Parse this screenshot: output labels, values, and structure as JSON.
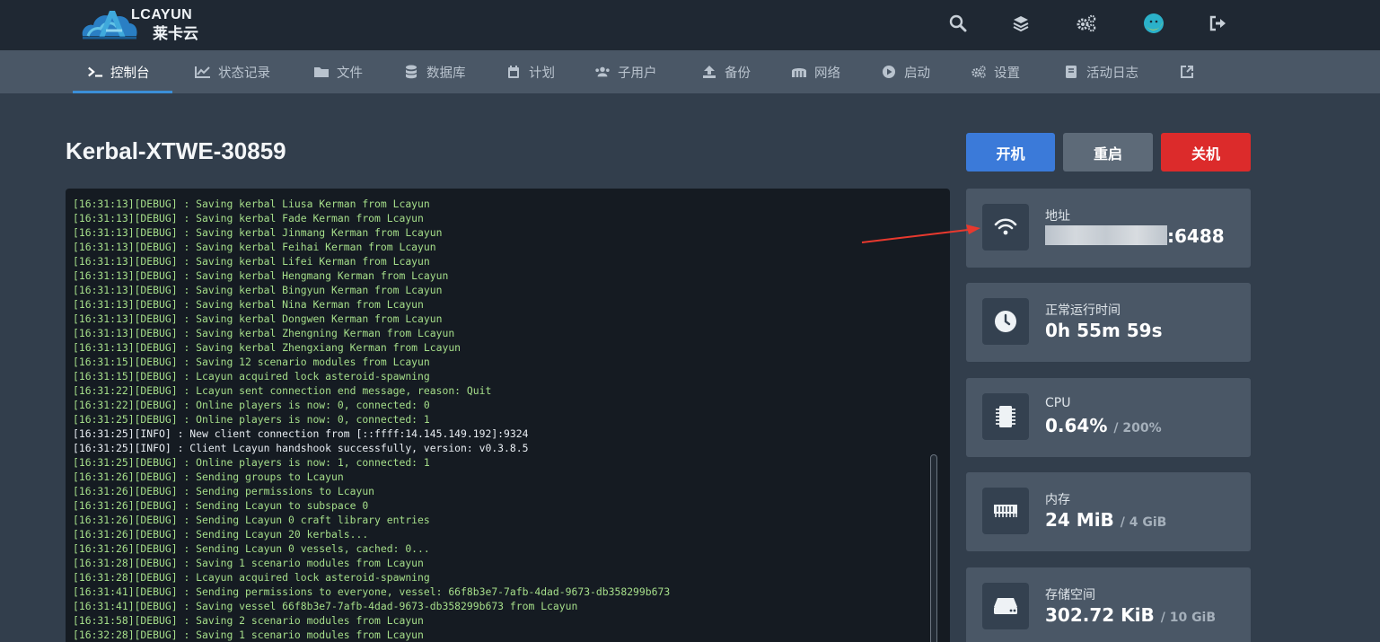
{
  "brand": {
    "name_en": "LCAYUN",
    "name_cn": "莱卡云"
  },
  "topbar": {
    "icons": [
      "search-icon",
      "layers-icon",
      "cogs-icon",
      "avatar",
      "logout-icon"
    ]
  },
  "nav": {
    "items": [
      {
        "label": "控制台",
        "icon": "terminal-icon"
      },
      {
        "label": "状态记录",
        "icon": "chart-icon"
      },
      {
        "label": "文件",
        "icon": "folder-icon"
      },
      {
        "label": "数据库",
        "icon": "database-icon"
      },
      {
        "label": "计划",
        "icon": "calendar-icon"
      },
      {
        "label": "子用户",
        "icon": "users-icon"
      },
      {
        "label": "备份",
        "icon": "upload-icon"
      },
      {
        "label": "网络",
        "icon": "network-icon"
      },
      {
        "label": "启动",
        "icon": "play-icon"
      },
      {
        "label": "设置",
        "icon": "cogs-icon"
      },
      {
        "label": "活动日志",
        "icon": "book-icon"
      },
      {
        "label": "",
        "icon": "external-link-icon"
      }
    ]
  },
  "server": {
    "name": "Kerbal-XTWE-30859"
  },
  "power": {
    "start": "开机",
    "restart": "重启",
    "stop": "关机"
  },
  "console": {
    "lines": [
      {
        "level": "debug",
        "text": "[16:31:13][DEBUG] : Saving kerbal Liusa Kerman from Lcayun"
      },
      {
        "level": "debug",
        "text": "[16:31:13][DEBUG] : Saving kerbal Fade Kerman from Lcayun"
      },
      {
        "level": "debug",
        "text": "[16:31:13][DEBUG] : Saving kerbal Jinmang Kerman from Lcayun"
      },
      {
        "level": "debug",
        "text": "[16:31:13][DEBUG] : Saving kerbal Feihai Kerman from Lcayun"
      },
      {
        "level": "debug",
        "text": "[16:31:13][DEBUG] : Saving kerbal Lifei Kerman from Lcayun"
      },
      {
        "level": "debug",
        "text": "[16:31:13][DEBUG] : Saving kerbal Hengmang Kerman from Lcayun"
      },
      {
        "level": "debug",
        "text": "[16:31:13][DEBUG] : Saving kerbal Bingyun Kerman from Lcayun"
      },
      {
        "level": "debug",
        "text": "[16:31:13][DEBUG] : Saving kerbal Nina Kerman from Lcayun"
      },
      {
        "level": "debug",
        "text": "[16:31:13][DEBUG] : Saving kerbal Dongwen Kerman from Lcayun"
      },
      {
        "level": "debug",
        "text": "[16:31:13][DEBUG] : Saving kerbal Zhengning Kerman from Lcayun"
      },
      {
        "level": "debug",
        "text": "[16:31:13][DEBUG] : Saving kerbal Zhengxiang Kerman from Lcayun"
      },
      {
        "level": "debug",
        "text": "[16:31:15][DEBUG] : Saving 12 scenario modules from Lcayun"
      },
      {
        "level": "debug",
        "text": "[16:31:15][DEBUG] : Lcayun acquired lock asteroid-spawning"
      },
      {
        "level": "debug",
        "text": "[16:31:22][DEBUG] : Lcayun sent connection end message, reason: Quit"
      },
      {
        "level": "debug",
        "text": "[16:31:22][DEBUG] : Online players is now: 0, connected: 0"
      },
      {
        "level": "debug",
        "text": "[16:31:25][DEBUG] : Online players is now: 0, connected: 1"
      },
      {
        "level": "info",
        "text": "[16:31:25][INFO] : New client connection from [::ffff:14.145.149.192]:9324"
      },
      {
        "level": "info",
        "text": "[16:31:25][INFO] : Client Lcayun handshook successfully, version: v0.3.8.5"
      },
      {
        "level": "debug",
        "text": "[16:31:25][DEBUG] : Online players is now: 1, connected: 1"
      },
      {
        "level": "debug",
        "text": "[16:31:26][DEBUG] : Sending groups to Lcayun"
      },
      {
        "level": "debug",
        "text": "[16:31:26][DEBUG] : Sending permissions to Lcayun"
      },
      {
        "level": "debug",
        "text": "[16:31:26][DEBUG] : Sending Lcayun to subspace 0"
      },
      {
        "level": "debug",
        "text": "[16:31:26][DEBUG] : Sending Lcayun 0 craft library entries"
      },
      {
        "level": "debug",
        "text": "[16:31:26][DEBUG] : Sending Lcayun 20 kerbals..."
      },
      {
        "level": "debug",
        "text": "[16:31:26][DEBUG] : Sending Lcayun 0 vessels, cached: 0..."
      },
      {
        "level": "debug",
        "text": "[16:31:28][DEBUG] : Saving 1 scenario modules from Lcayun"
      },
      {
        "level": "debug",
        "text": "[16:31:28][DEBUG] : Lcayun acquired lock asteroid-spawning"
      },
      {
        "level": "debug",
        "text": "[16:31:41][DEBUG] : Sending permissions to everyone, vessel: 66f8b3e7-7afb-4dad-9673-db358299b673"
      },
      {
        "level": "debug",
        "text": "[16:31:41][DEBUG] : Saving vessel 66f8b3e7-7afb-4dad-9673-db358299b673 from Lcayun"
      },
      {
        "level": "debug",
        "text": "[16:31:58][DEBUG] : Saving 2 scenario modules from Lcayun"
      },
      {
        "level": "debug",
        "text": "[16:32:28][DEBUG] : Saving 1 scenario modules from Lcayun"
      }
    ]
  },
  "stats": {
    "address": {
      "label": "地址",
      "port": ":6488"
    },
    "uptime": {
      "label": "正常运行时间",
      "value": "0h 55m 59s"
    },
    "cpu": {
      "label": "CPU",
      "value": "0.64%",
      "limit": "/ 200%"
    },
    "memory": {
      "label": "内存",
      "value": "24 MiB",
      "limit": "/ 4 GiB"
    },
    "disk": {
      "label": "存储空间",
      "value": "302.72 KiB",
      "limit": "/ 10 GiB"
    }
  },
  "colors": {
    "start": "#3b7ad9",
    "restart": "#5d6a78",
    "stop": "#dc2b2b",
    "accent": "#3b8fd8",
    "arrow": "#e8392e"
  }
}
